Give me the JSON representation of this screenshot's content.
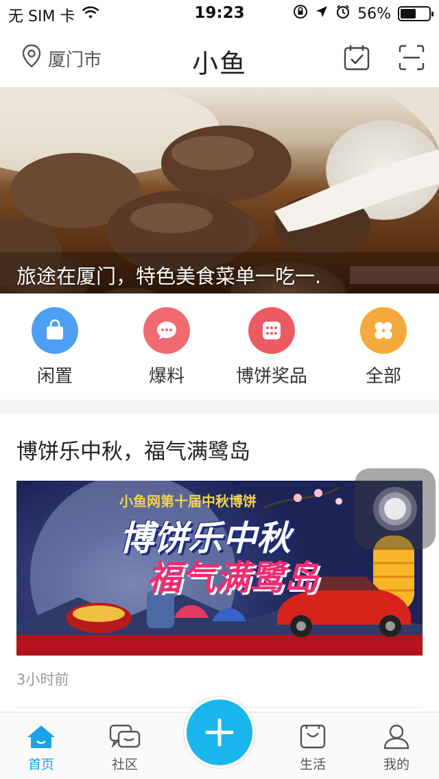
{
  "status_bar": {
    "carrier": "无 SIM 卡",
    "time": "19:23",
    "battery_percent": "56%",
    "battery_level": 0.56
  },
  "nav": {
    "location": "厦门市",
    "logo": "小鱼"
  },
  "banner": {
    "caption": "旅途在厦门，特色美食菜单一吃一."
  },
  "quick_menu": [
    {
      "label": "闲置",
      "icon": "bag-icon",
      "color": "#4d9ef5"
    },
    {
      "label": "爆料",
      "icon": "chat-bubble-icon",
      "color": "#f06a70"
    },
    {
      "label": "博饼奖品",
      "icon": "dice-icon",
      "color": "#ec5b62"
    },
    {
      "label": "全部",
      "icon": "grid-icon",
      "color": "#f6a93b"
    }
  ],
  "article": {
    "title": "博饼乐中秋，福气满鹭岛",
    "image_headline": "小鱼网第十届中秋博饼",
    "image_slogan_1": "博饼乐中秋",
    "image_slogan_2": "福气满鹭岛",
    "time": "3小时前"
  },
  "tabs": [
    {
      "label": "首页",
      "icon": "home-icon",
      "active": true
    },
    {
      "label": "社区",
      "icon": "community-icon",
      "active": false
    },
    {
      "label": "生活",
      "icon": "life-icon",
      "active": false
    },
    {
      "label": "我的",
      "icon": "profile-icon",
      "active": false
    }
  ],
  "colors": {
    "accent": "#1aa3e8",
    "fab": "#19b6ee"
  }
}
